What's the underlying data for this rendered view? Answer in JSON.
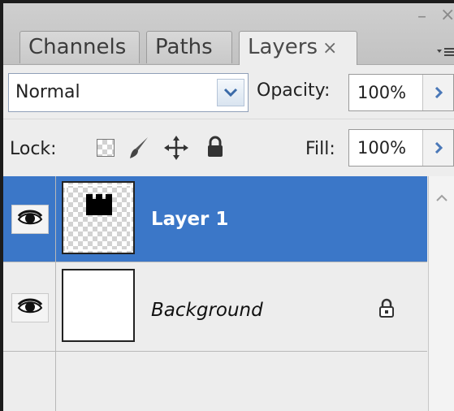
{
  "tabs": [
    {
      "label": "Channels"
    },
    {
      "label": "Paths"
    },
    {
      "label": "Layers",
      "close": "×"
    }
  ],
  "window": {
    "minimize": "–",
    "close": "×"
  },
  "blend_mode": {
    "value": "Normal"
  },
  "opacity": {
    "label": "Opacity:",
    "value": "100%"
  },
  "lock": {
    "label": "Lock:"
  },
  "fill": {
    "label": "Fill:",
    "value": "100%"
  },
  "layers": [
    {
      "name": "Layer 1",
      "selected": true
    },
    {
      "name": "Background",
      "locked": true
    }
  ],
  "colors": {
    "selection": "#3b77c8",
    "panel": "#ededed"
  }
}
